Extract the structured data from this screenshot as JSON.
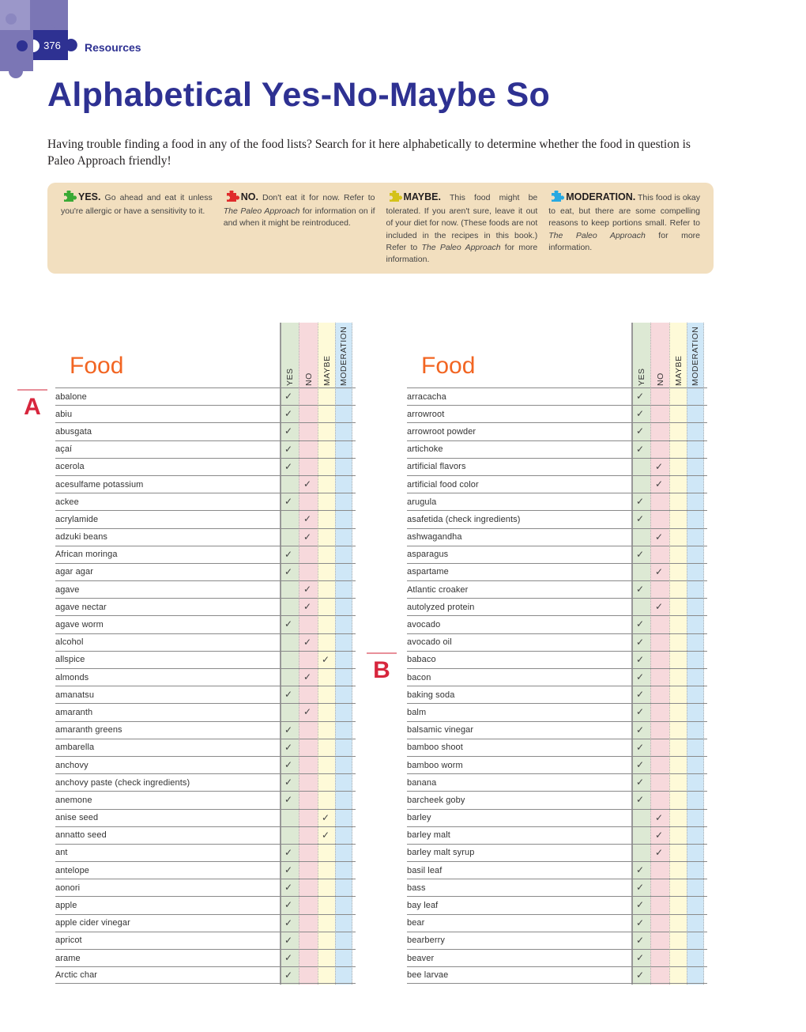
{
  "header": {
    "page_number": "376",
    "section": "Resources",
    "title": "Alphabetical Yes-No-Maybe So"
  },
  "intro": "Having trouble finding a food in any of the food lists? Search for it here alphabetically to determine whether the food in question is Paleo Approach friendly!",
  "legend": [
    {
      "key": "yes",
      "color": "#3aaa35",
      "head": "YES.",
      "text": " Go ahead and eat it unless you're allergic or have a sensitivity to it."
    },
    {
      "key": "no",
      "color": "#e02b2b",
      "head": "NO.",
      "text_before": " Don't eat it for now. Refer to ",
      "italic": "The Paleo Approach",
      "text_after": " for information on if and when it might be reintroduced."
    },
    {
      "key": "maybe",
      "color": "#d4c21a",
      "head": "MAYBE.",
      "text_before": " This food might be tolerated. If you aren't sure, leave it out of your diet for now. (These foods are not included in the recipes in this book.) Refer to ",
      "italic": "The Paleo Approach",
      "text_after": " for more information."
    },
    {
      "key": "moderation",
      "color": "#27a9e1",
      "head": "MODERATION.",
      "text_before": " This food is okay to eat, but there are some compelling reasons to keep portions small. Refer to ",
      "italic": "The Paleo Approach",
      "text_after": " for more information."
    }
  ],
  "table": {
    "food_header": "Food",
    "column_headers": [
      "YES",
      "NO",
      "MAYBE",
      "MODERATION"
    ],
    "left": {
      "letters": [
        {
          "letter": "A",
          "before_row": 0
        }
      ],
      "rows": [
        {
          "name": "abalone",
          "status": "yes"
        },
        {
          "name": "abiu",
          "status": "yes"
        },
        {
          "name": "abusgata",
          "status": "yes"
        },
        {
          "name": "açaí",
          "status": "yes"
        },
        {
          "name": "acerola",
          "status": "yes"
        },
        {
          "name": "acesulfame potassium",
          "status": "no"
        },
        {
          "name": "ackee",
          "status": "yes"
        },
        {
          "name": "acrylamide",
          "status": "no"
        },
        {
          "name": "adzuki beans",
          "status": "no"
        },
        {
          "name": "African moringa",
          "status": "yes"
        },
        {
          "name": "agar agar",
          "status": "yes"
        },
        {
          "name": "agave",
          "status": "no"
        },
        {
          "name": "agave nectar",
          "status": "no"
        },
        {
          "name": "agave worm",
          "status": "yes"
        },
        {
          "name": "alcohol",
          "status": "no"
        },
        {
          "name": "allspice",
          "status": "maybe"
        },
        {
          "name": "almonds",
          "status": "no"
        },
        {
          "name": "amanatsu",
          "status": "yes"
        },
        {
          "name": "amaranth",
          "status": "no"
        },
        {
          "name": "amaranth greens",
          "status": "yes"
        },
        {
          "name": "ambarella",
          "status": "yes"
        },
        {
          "name": "anchovy",
          "status": "yes"
        },
        {
          "name": "anchovy paste (check ingredients)",
          "status": "yes"
        },
        {
          "name": "anemone",
          "status": "yes"
        },
        {
          "name": "anise seed",
          "status": "maybe"
        },
        {
          "name": "annatto seed",
          "status": "maybe"
        },
        {
          "name": "ant",
          "status": "yes"
        },
        {
          "name": "antelope",
          "status": "yes"
        },
        {
          "name": "aonori",
          "status": "yes"
        },
        {
          "name": "apple",
          "status": "yes"
        },
        {
          "name": "apple cider vinegar",
          "status": "yes"
        },
        {
          "name": "apricot",
          "status": "yes"
        },
        {
          "name": "arame",
          "status": "yes"
        },
        {
          "name": "Arctic char",
          "status": "yes"
        }
      ]
    },
    "right": {
      "letters": [
        {
          "letter": "B",
          "before_row": 15
        }
      ],
      "rows": [
        {
          "name": "arracacha",
          "status": "yes"
        },
        {
          "name": "arrowroot",
          "status": "yes"
        },
        {
          "name": "arrowroot powder",
          "status": "yes"
        },
        {
          "name": "artichoke",
          "status": "yes"
        },
        {
          "name": "artificial flavors",
          "status": "no"
        },
        {
          "name": "artificial food color",
          "status": "no"
        },
        {
          "name": "arugula",
          "status": "yes"
        },
        {
          "name": "asafetida (check ingredients)",
          "status": "yes"
        },
        {
          "name": "ashwagandha",
          "status": "no"
        },
        {
          "name": "asparagus",
          "status": "yes"
        },
        {
          "name": "aspartame",
          "status": "no"
        },
        {
          "name": "Atlantic croaker",
          "status": "yes"
        },
        {
          "name": "autolyzed protein",
          "status": "no"
        },
        {
          "name": "avocado",
          "status": "yes"
        },
        {
          "name": "avocado oil",
          "status": "yes"
        },
        {
          "name": "babaco",
          "status": "yes"
        },
        {
          "name": "bacon",
          "status": "yes"
        },
        {
          "name": "baking soda",
          "status": "yes"
        },
        {
          "name": "balm",
          "status": "yes"
        },
        {
          "name": "balsamic vinegar",
          "status": "yes"
        },
        {
          "name": "bamboo shoot",
          "status": "yes"
        },
        {
          "name": "bamboo worm",
          "status": "yes"
        },
        {
          "name": "banana",
          "status": "yes"
        },
        {
          "name": "barcheek goby",
          "status": "yes"
        },
        {
          "name": "barley",
          "status": "no"
        },
        {
          "name": "barley malt",
          "status": "no"
        },
        {
          "name": "barley malt syrup",
          "status": "no"
        },
        {
          "name": "basil leaf",
          "status": "yes"
        },
        {
          "name": "bass",
          "status": "yes"
        },
        {
          "name": "bay leaf",
          "status": "yes"
        },
        {
          "name": "bear",
          "status": "yes"
        },
        {
          "name": "bearberry",
          "status": "yes"
        },
        {
          "name": "beaver",
          "status": "yes"
        },
        {
          "name": "bee larvae",
          "status": "yes"
        }
      ]
    },
    "check_glyph": "✓"
  },
  "colors": {
    "title": "#2e3192",
    "food_header": "#f26522",
    "letter": "#d7263d",
    "yes_band": "#dde9d4",
    "no_band": "#f7d9dc",
    "maybe_band": "#fefad8",
    "moderation_band": "#cfe7f7",
    "legend_bg": "#f2dfbf"
  }
}
